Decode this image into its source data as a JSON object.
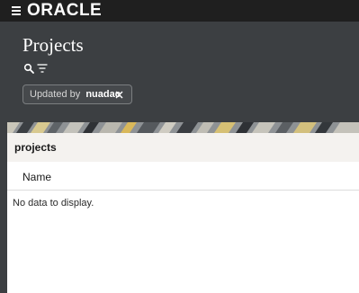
{
  "topbar": {
    "logo": "ORACLE"
  },
  "header": {
    "title": "Projects",
    "filter_chip": {
      "label": "Updated by",
      "value": "nuadac"
    }
  },
  "panel": {
    "title": "projects",
    "columns": [
      "Name"
    ],
    "empty_message": "No data to display."
  },
  "icons": [
    "menu-icon",
    "search-icon",
    "filter-icon",
    "close-icon"
  ],
  "colors": {
    "topbar": "#1f1f1f",
    "header": "#3c3f42",
    "panel_header": "#f4f2ef"
  }
}
